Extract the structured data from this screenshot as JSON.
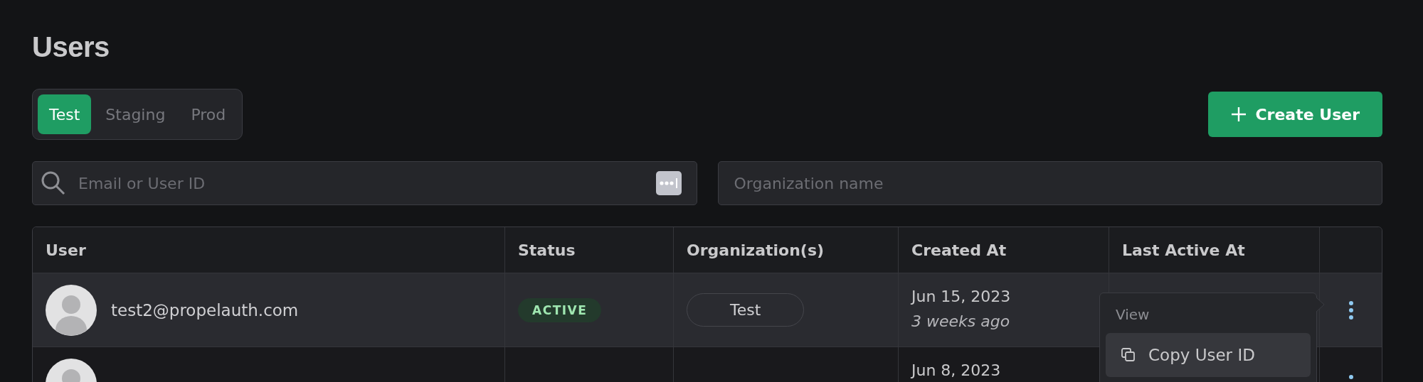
{
  "title": "Users",
  "tabs": [
    {
      "label": "Test",
      "selected": true
    },
    {
      "label": "Staging",
      "selected": false
    },
    {
      "label": "Prod",
      "selected": false
    }
  ],
  "create_button": "Create User",
  "search": {
    "placeholder": "Email or User ID"
  },
  "org_search": {
    "placeholder": "Organization name"
  },
  "table": {
    "columns": [
      "User",
      "Status",
      "Organization(s)",
      "Created At",
      "Last Active At"
    ],
    "rows": [
      {
        "email": "test2@propelauth.com",
        "status": "ACTIVE",
        "organizations": [
          "Test"
        ],
        "created": "Jun 15, 2023",
        "created_relative": "3 weeks ago",
        "hovered": true
      },
      {
        "created": "Jun 8, 2023",
        "hovered": false
      }
    ]
  },
  "menu": {
    "header": "View",
    "items": [
      {
        "label": "Copy User ID",
        "selected": true
      }
    ]
  }
}
